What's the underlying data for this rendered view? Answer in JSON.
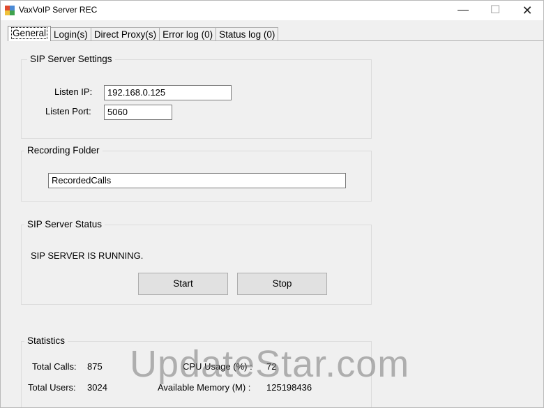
{
  "window": {
    "title": "VaxVoIP Server REC",
    "minimize_glyph": "—",
    "maximize_glyph": "☐",
    "close_glyph": "✕"
  },
  "tabs": [
    {
      "label": "General",
      "active": true
    },
    {
      "label": "Login(s)",
      "active": false
    },
    {
      "label": "Direct Proxy(s)",
      "active": false
    },
    {
      "label": "Error log (0)",
      "active": false
    },
    {
      "label": "Status log (0)",
      "active": false
    }
  ],
  "sip_settings": {
    "title": "SIP Server Settings",
    "listen_ip_label": "Listen IP:",
    "listen_ip_value": "192.168.0.125",
    "listen_port_label": "Listen Port:",
    "listen_port_value": "5060"
  },
  "recording": {
    "title": "Recording Folder",
    "folder_value": "RecordedCalls"
  },
  "status": {
    "title": "SIP Server Status",
    "message": "SIP SERVER IS RUNNING.",
    "start_label": "Start",
    "stop_label": "Stop"
  },
  "statistics": {
    "title": "Statistics",
    "total_calls_label": "Total Calls:",
    "total_calls_value": "875",
    "cpu_label": "CPU Usage (%) :",
    "cpu_value": "72",
    "total_users_label": "Total Users:",
    "total_users_value": "3024",
    "memory_label": "Available Memory (M) :",
    "memory_value": "125198436"
  },
  "watermark": "UpdateStar.com"
}
